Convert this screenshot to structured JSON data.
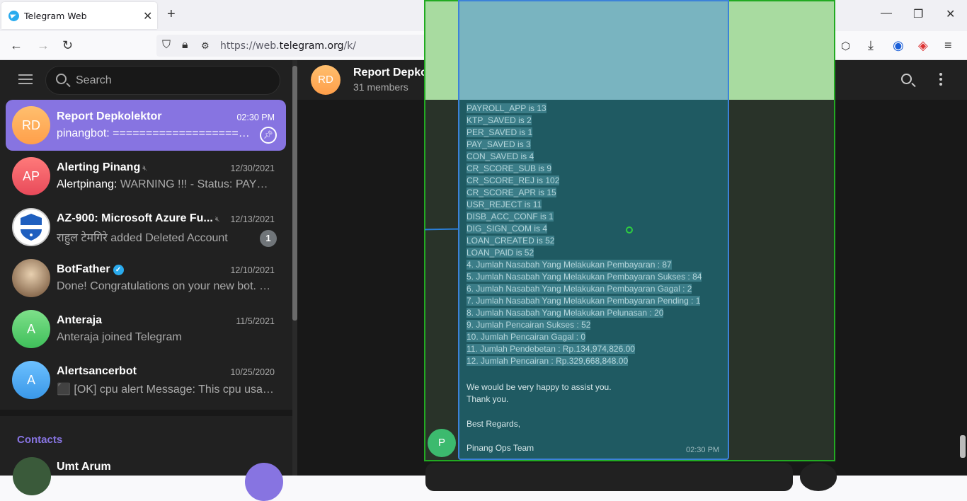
{
  "browser": {
    "tab_title": "Telegram Web",
    "tab_close": "✕",
    "new_tab": "+",
    "url_prefix": "https://web.",
    "url_domain": "telegram.org",
    "url_path": "/k/"
  },
  "sidebar": {
    "search_placeholder": "Search",
    "chats": [
      {
        "initials": "RD",
        "name": "Report Depkolektor",
        "time": "02:30 PM",
        "message": "pinangbot: ======================",
        "color": "#ffa84f"
      },
      {
        "initials": "AP",
        "name": "Alerting Pinang",
        "time": "12/30/2021",
        "sender": "Alertpinang:",
        "message": " WARNING !!! - Status: PAYROLL_APP",
        "color": "#f05a5a"
      },
      {
        "initials": "",
        "name": "AZ-900: Microsoft Azure Fu...",
        "time": "12/13/2021",
        "message": "राहुल टेमगिरे added Deleted Account",
        "badge": "1",
        "color": "#ffffff"
      },
      {
        "initials": "",
        "name": "BotFather",
        "time": "12/10/2021",
        "message": "Done! Congratulations on your new bot. You",
        "color": "#7a5a3a"
      },
      {
        "initials": "A",
        "name": "Anteraja",
        "time": "11/5/2021",
        "message": "Anteraja joined Telegram",
        "color": "#4cc46a"
      },
      {
        "initials": "A",
        "name": "Alertsancerbot",
        "time": "10/25/2020",
        "message": "⬛ [OK] cpu alert Message: This cpu usage is",
        "color": "#3fa3f0"
      }
    ],
    "contacts_heading": "Contacts",
    "contact_name": "Umt Arum"
  },
  "header": {
    "initials": "RD",
    "title": "Report Depkolektor",
    "subtitle": "31 members"
  },
  "message": {
    "selected_lines": [
      "PAYROLL_APP is 13",
      "KTP_SAVED is 2",
      "PER_SAVED is 1",
      "PAY_SAVED is 3",
      "CON_SAVED is 4",
      "CR_SCORE_SUB is 9",
      "CR_SCORE_REJ is 102",
      "CR_SCORE_APR is 15",
      "USR_REJECT is 11",
      "DISB_ACC_CONF is 1",
      "DIG_SIGN_COM is 4",
      "LOAN_CREATED is 52",
      "LOAN_PAID is 52",
      "4. Jumlah Nasabah Yang Melakukan Pembayaran   : 87",
      "5. Jumlah Nasabah Yang Melakukan Pembayaran Sukses   : 84",
      "6. Jumlah Nasabah Yang Melakukan Pembayaran Gagal   : 2",
      "7. Jumlah Nasabah Yang Melakukan Pembayaran Pending   : 1",
      "8. Jumlah Nasabah Yang Melakukan Pelunasan   : 20",
      "9. Jumlah Pencairan Sukses   : 52",
      "10. Jumlah Pencairan Gagal   : 0",
      "11. Jumlah Pendebetan   : Rp.134,974,826.00",
      "12. Jumlah Pencairan   : Rp.329,668,848.00"
    ],
    "closing_1": "We would be very happy to assist you.",
    "closing_2": "Thank you.",
    "regards": "Best Regards,",
    "signature": "Pinang Ops Team",
    "time": "02:30 PM",
    "sender_initial": "P"
  }
}
